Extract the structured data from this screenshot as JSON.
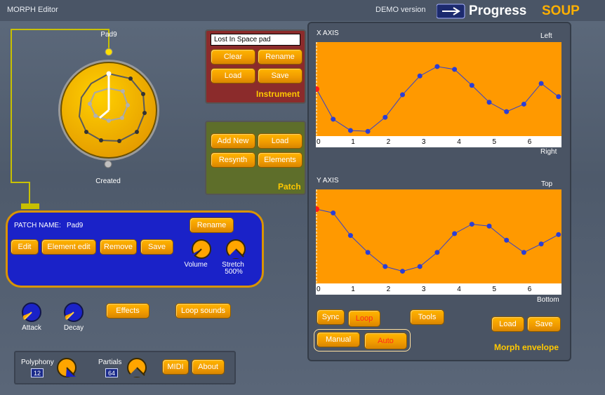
{
  "app": {
    "title": "MORPH Editor",
    "demo": "DEMO version",
    "logo_main": "Progress",
    "logo_accent": "SOUP"
  },
  "pad": {
    "top_label": "Pad9",
    "bottom_label": "Created"
  },
  "instrument": {
    "field_value": "Lost In Space pad",
    "clear": "Clear",
    "rename": "Rename",
    "load": "Load",
    "save": "Save",
    "heading": "Instrument"
  },
  "patch": {
    "add_new": "Add New",
    "load": "Load",
    "resynth": "Resynth",
    "elements": "Elements",
    "heading": "Patch"
  },
  "patch_panel": {
    "name_label": "PATCH NAME:",
    "name_value": "Pad9",
    "rename": "Rename",
    "edit": "Edit",
    "element_edit": "Element edit",
    "remove": "Remove",
    "save": "Save",
    "volume": "Volume",
    "stretch": "Stretch",
    "stretch_value": "500%"
  },
  "controls": {
    "attack": "Attack",
    "decay": "Decay",
    "effects": "Effects",
    "loop_sounds": "Loop sounds"
  },
  "bottom": {
    "polyphony": "Polyphony",
    "polyphony_value": "12",
    "partials": "Partials",
    "partials_value": "64",
    "midi": "MIDI",
    "about": "About"
  },
  "envelope": {
    "x_title": "X AXIS",
    "x_left": "Left",
    "x_right": "Right",
    "y_title": "Y AXIS",
    "y_top": "Top",
    "y_bottom": "Bottom",
    "ticks": [
      "0",
      "1",
      "2",
      "3",
      "4",
      "5",
      "6"
    ],
    "sync": "Sync",
    "loop": "Loop",
    "tools": "Tools",
    "manual": "Manual",
    "auto": "Auto",
    "load": "Load",
    "save": "Save",
    "heading": "Morph envelope",
    "x_points": [
      0.5,
      0.82,
      0.94,
      0.95,
      0.8,
      0.56,
      0.36,
      0.26,
      0.29,
      0.46,
      0.64,
      0.74,
      0.66,
      0.44,
      0.58
    ],
    "y_points": [
      0.21,
      0.25,
      0.49,
      0.67,
      0.82,
      0.87,
      0.82,
      0.67,
      0.47,
      0.37,
      0.39,
      0.54,
      0.67,
      0.58,
      0.48
    ]
  },
  "colors": {
    "orange": "#ff9900",
    "point": "#2b3fd6",
    "line": "#3040d0"
  }
}
